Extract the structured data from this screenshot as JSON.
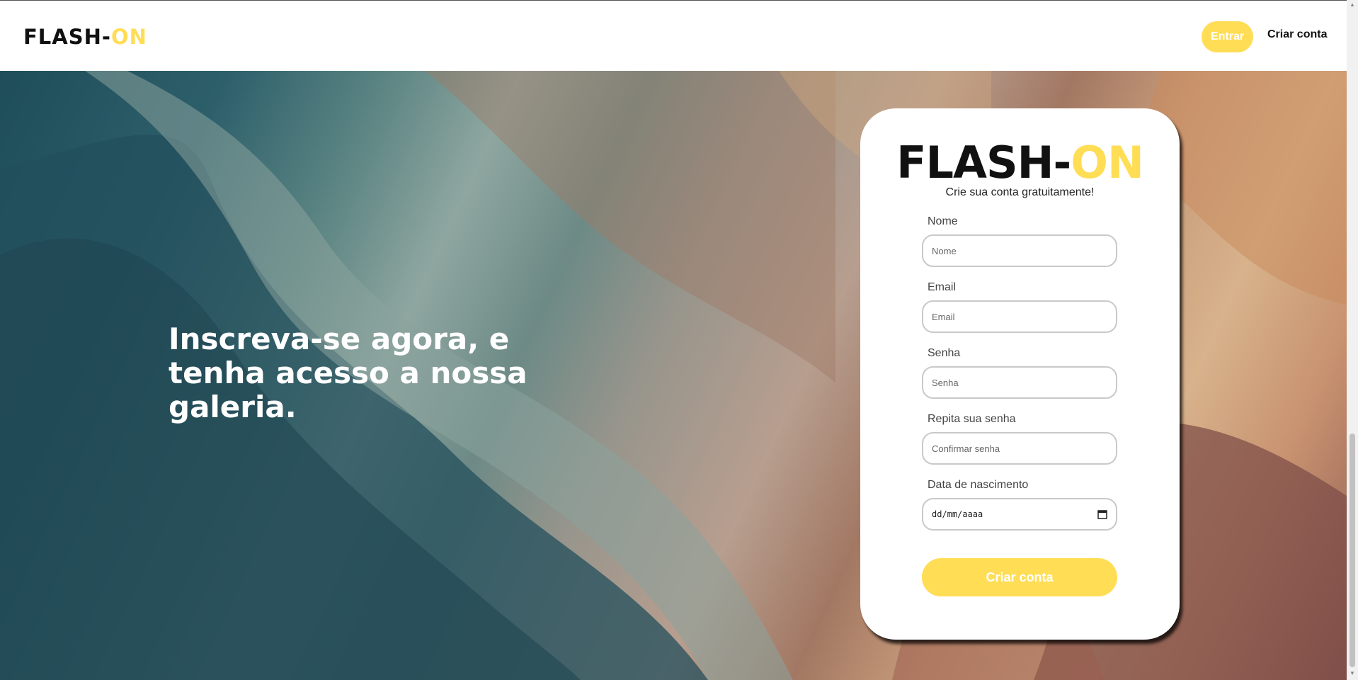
{
  "theme": {
    "accent": "#ffdd55"
  },
  "header": {
    "logo_main": "FLASH-",
    "logo_accent": "ON",
    "login_label": "Entrar",
    "signup_label": "Criar conta"
  },
  "hero": {
    "title": "Inscreva-se agora, e tenha acesso a nossa galeria."
  },
  "form": {
    "logo_main": "FLASH-",
    "logo_accent": "ON",
    "subtitle": "Crie sua conta gratuitamente!",
    "fields": [
      {
        "label": "Nome",
        "placeholder": "Nome"
      },
      {
        "label": "Email",
        "placeholder": "Email"
      },
      {
        "label": "Senha",
        "placeholder": "Senha"
      },
      {
        "label": "Repita sua senha",
        "placeholder": "Confirmar senha"
      },
      {
        "label": "Data de nascimento",
        "placeholder": "dd/mm/aaaa"
      }
    ],
    "submit_label": "Criar conta",
    "icons": {
      "date": "calendar-icon"
    }
  }
}
